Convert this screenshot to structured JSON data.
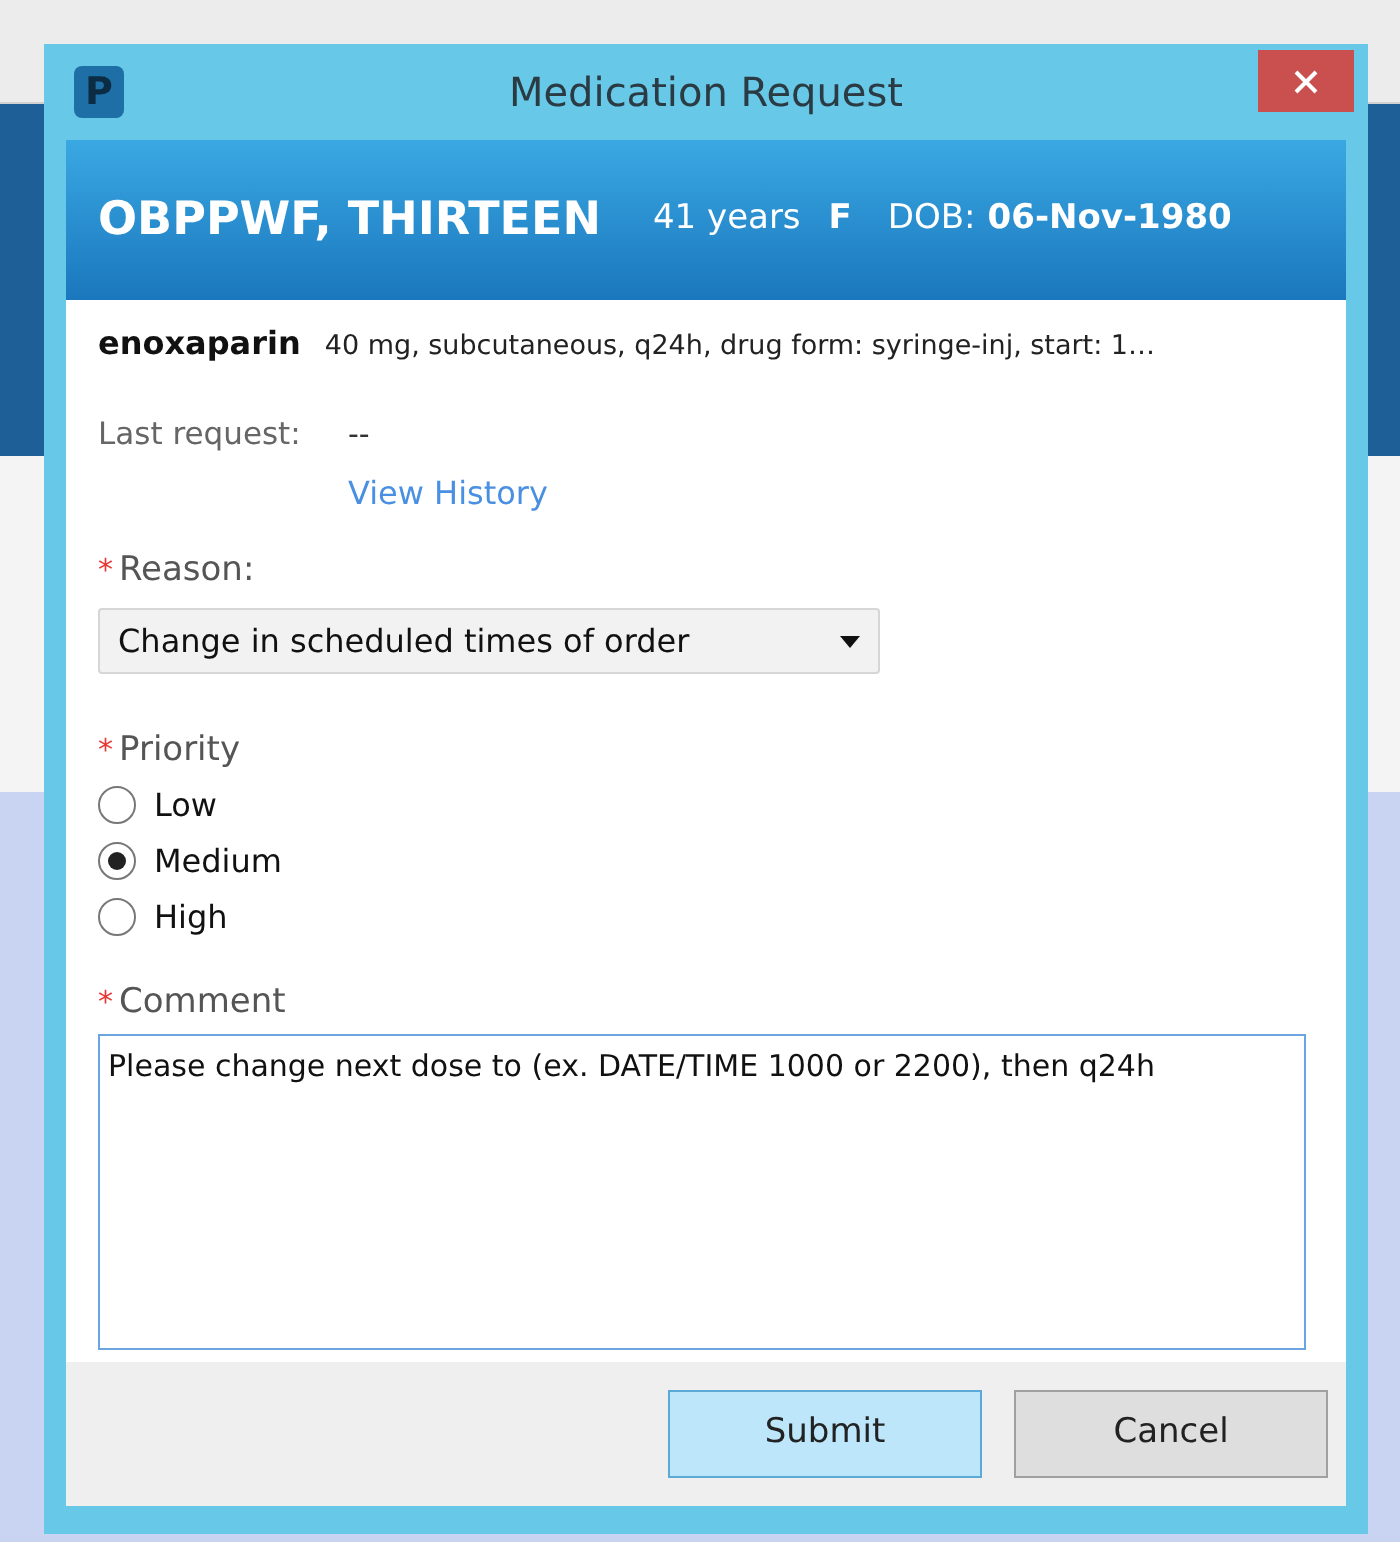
{
  "window": {
    "app_icon": "P",
    "title": "Medication Request"
  },
  "patient": {
    "name": "OBPPWF, THIRTEEN",
    "age": "41 years",
    "sex": "F",
    "dob_label": "DOB:",
    "dob": "06-Nov-1980"
  },
  "medication": {
    "name": "enoxaparin",
    "details": "40 mg, subcutaneous, q24h, drug form: syringe-inj, start: 1…"
  },
  "last_request": {
    "label": "Last request:",
    "value": "--",
    "link": "View History"
  },
  "reason": {
    "required_mark": "*",
    "label": "Reason:",
    "value": "Change in scheduled times of order"
  },
  "priority": {
    "required_mark": "*",
    "label": "Priority",
    "options": [
      {
        "label": "Low",
        "selected": false
      },
      {
        "label": "Medium",
        "selected": true
      },
      {
        "label": "High",
        "selected": false
      }
    ]
  },
  "comment": {
    "required_mark": "*",
    "label": "Comment",
    "value": "Please change next dose to (ex. DATE/TIME 1000 or 2200), then q24h"
  },
  "buttons": [
    {
      "label": "Submit",
      "kind": "primary"
    },
    {
      "label": "Cancel",
      "kind": "secondary"
    }
  ]
}
